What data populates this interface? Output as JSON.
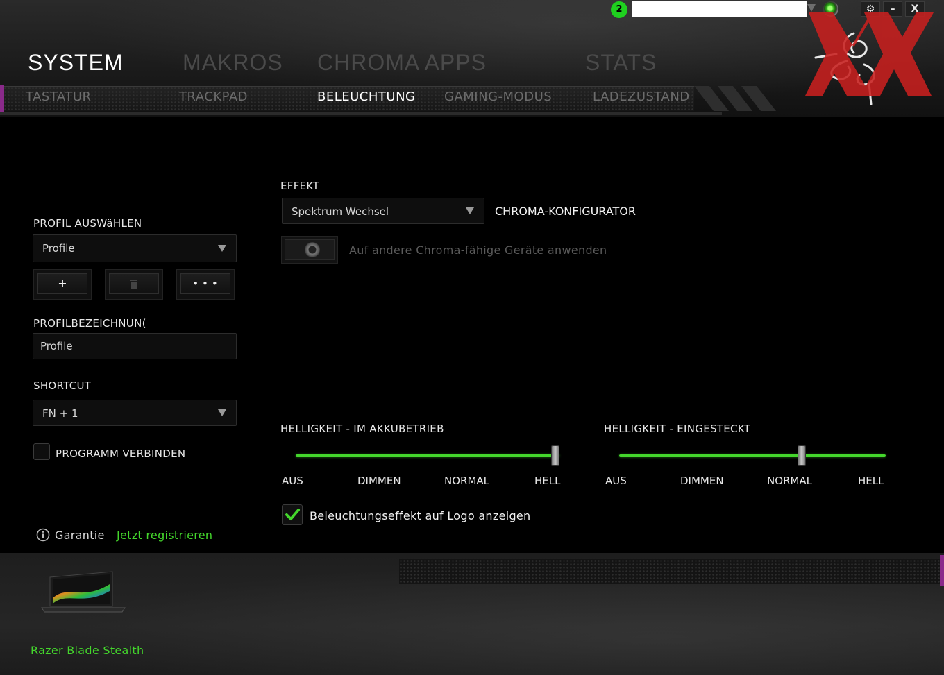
{
  "titlebar": {
    "badge_count": "2",
    "search_value": "",
    "window_buttons": [
      "⚙",
      "–",
      "X"
    ]
  },
  "main_tabs": [
    {
      "label": "SYSTEM",
      "active": true
    },
    {
      "label": "MAKROS",
      "active": false
    },
    {
      "label": "CHROMA APPS",
      "active": false
    },
    {
      "label": "STATS",
      "active": false
    }
  ],
  "sub_tabs": [
    {
      "label": "TASTATUR",
      "active": false
    },
    {
      "label": "TRACKPAD",
      "active": false
    },
    {
      "label": "BELEUCHTUNG",
      "active": true
    },
    {
      "label": "GAMING-MODUS",
      "active": false
    },
    {
      "label": "LADEZUSTAND",
      "active": false
    }
  ],
  "profile": {
    "select_label": "PROFIL AUSWäHLEN",
    "select_value": "Profile",
    "add_button": "+",
    "delete_icon": "trash-icon",
    "more_button": "• • •",
    "name_label": "PROFILBEZEICHNUN(",
    "name_value": "Profile",
    "shortcut_label": "SHORTCUT",
    "shortcut_value": "FN + 1",
    "link_program_label": "PROGRAMM VERBINDEN",
    "link_program_checked": false
  },
  "warranty": {
    "label": "Garantie",
    "register_link": "Jetzt registrieren"
  },
  "effect": {
    "label": "EFFEKT",
    "value": "Spektrum Wechsel",
    "configurator_link": "CHROMA-KONFIGURATOR",
    "apply_all_label": "Auf andere Chroma-fähige Geräte anwenden",
    "apply_all_on": false
  },
  "brightness_battery": {
    "label": "HELLIGKEIT - IM AKKUBETRIEB",
    "ticks": [
      "AUS",
      "DIMMEN",
      "NORMAL",
      "HELL"
    ],
    "level": 1.0
  },
  "brightness_plugged": {
    "label": "HELLIGKEIT - EINGESTECKT",
    "ticks": [
      "AUS",
      "DIMMEN",
      "NORMAL",
      "HELL"
    ],
    "level": 0.69
  },
  "logo_effect": {
    "label": "Beleuchtungseffekt auf Logo anzeigen",
    "checked": true
  },
  "device": {
    "name": "Razer Blade Stealth"
  },
  "colors": {
    "accent_green": "#44d62c",
    "watermark_red": "#c8201f",
    "purple_accent": "#8a2a8a"
  }
}
